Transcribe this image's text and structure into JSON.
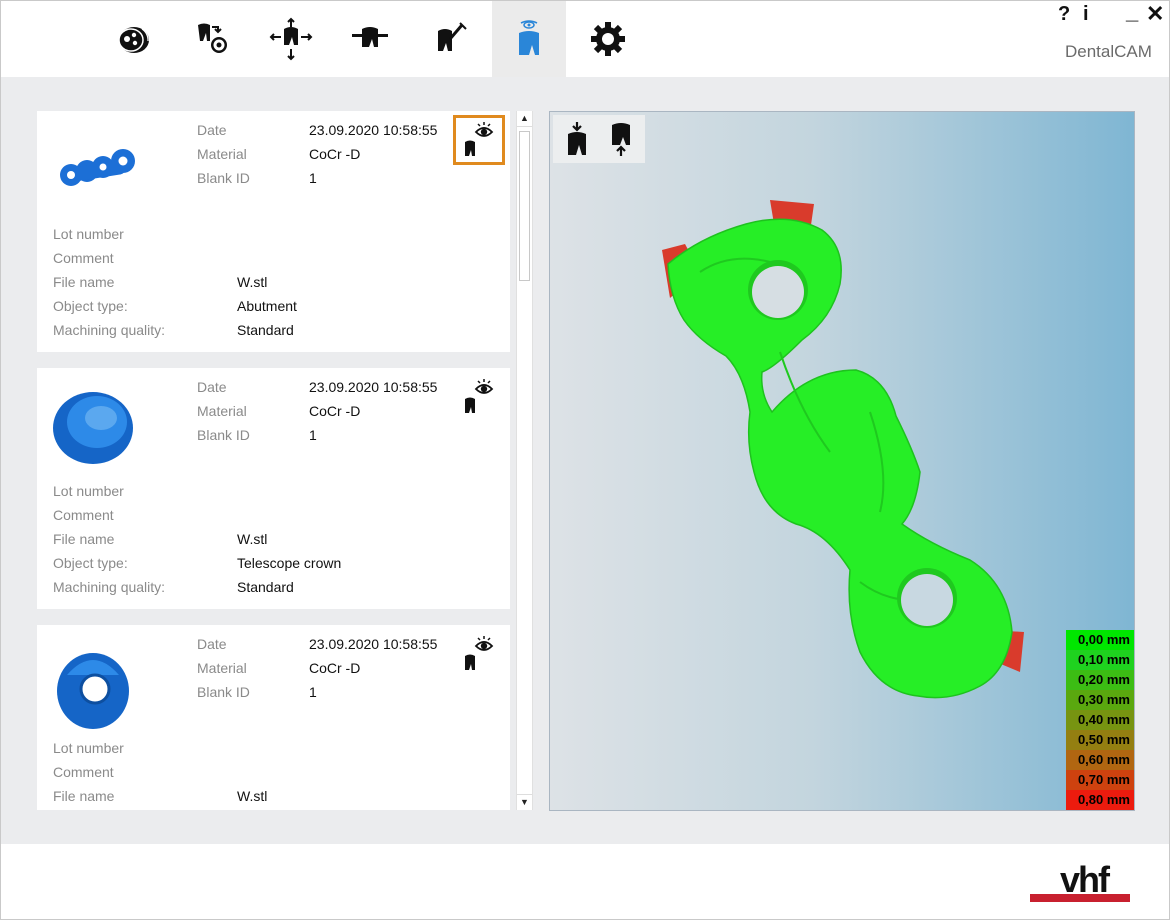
{
  "app": {
    "title": "DentalCAM",
    "help_label": "?",
    "info_label": "i",
    "minimize_label": "_",
    "close_label": "✕"
  },
  "toolbar": {
    "items": [
      {
        "icon": "blank-disc-icon",
        "active": false
      },
      {
        "icon": "tooth-import-icon",
        "active": false
      },
      {
        "icon": "tooth-move-icon",
        "active": false
      },
      {
        "icon": "tooth-holder-icon",
        "active": false
      },
      {
        "icon": "tooth-tool-icon",
        "active": false
      },
      {
        "icon": "tooth-view-icon",
        "active": true
      },
      {
        "icon": "gear-icon",
        "active": false
      }
    ]
  },
  "labels": {
    "date": "Date",
    "material": "Material",
    "blank_id": "Blank ID",
    "lot_number": "Lot number",
    "comment": "Comment",
    "file_name": "File name",
    "object_type": "Object type:",
    "machining_quality": "Machining quality:"
  },
  "cards": [
    {
      "date": "23.09.2020 10:58:55",
      "material": "CoCr -D",
      "blank_id": "1",
      "lot_number": "",
      "comment": "",
      "file_name": "W.stl",
      "object_type": "Abutment",
      "machining_quality": "Standard",
      "selected": true
    },
    {
      "date": "23.09.2020 10:58:55",
      "material": "CoCr -D",
      "blank_id": "1",
      "lot_number": "",
      "comment": "",
      "file_name": "W.stl",
      "object_type": "Telescope crown",
      "machining_quality": "Standard",
      "selected": false
    },
    {
      "date": "23.09.2020 10:58:55",
      "material": "CoCr -D",
      "blank_id": "1",
      "lot_number": "",
      "comment": "",
      "file_name": "W.stl",
      "selected": false
    }
  ],
  "viewer": {
    "tools": [
      {
        "icon": "tooth-view-top-icon"
      },
      {
        "icon": "tooth-view-bottom-icon"
      }
    ],
    "legend": [
      {
        "label": "0,00 mm",
        "color": "#00e600"
      },
      {
        "label": "0,10 mm",
        "color": "#1fd21f"
      },
      {
        "label": "0,20 mm",
        "color": "#3cbd14"
      },
      {
        "label": "0,30 mm",
        "color": "#5aa80f"
      },
      {
        "label": "0,40 mm",
        "color": "#779411"
      },
      {
        "label": "0,50 mm",
        "color": "#947f11"
      },
      {
        "label": "0,60 mm",
        "color": "#b16611"
      },
      {
        "label": "0,70 mm",
        "color": "#ce420f"
      },
      {
        "label": "0,80 mm",
        "color": "#ec1b0e"
      }
    ]
  },
  "footer": {
    "logo_text": "vhf",
    "logo_color": "#c8202f"
  }
}
